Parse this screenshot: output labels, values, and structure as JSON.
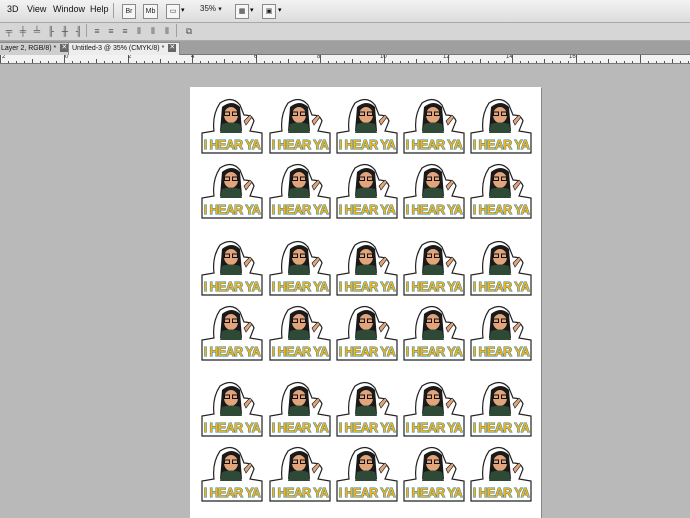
{
  "menu": {
    "items": [
      "3D",
      "View",
      "Window",
      "Help"
    ],
    "br_label": "Br",
    "mb_label": "Mb",
    "zoom": "35%"
  },
  "tabs": [
    {
      "label": "Layer 2, RGB/8) *",
      "active": false
    },
    {
      "label": "Untitled-3 @ 35% (CMYK/8) *",
      "active": true
    }
  ],
  "ruler": {
    "labels": [
      "2",
      "0",
      "2",
      "4",
      "6",
      "8",
      "10",
      "12",
      "14",
      "16"
    ]
  },
  "document": {
    "sticker_text": "I HEAR YA",
    "rows": 6,
    "columns": 5,
    "colors": {
      "text_fill": "#f2b21f",
      "text_stroke": "#1c7fa8",
      "hair": "#1a1a1a",
      "skin": "#e2a47a",
      "shirt": "#2e4a36",
      "outline": "#222222"
    }
  }
}
